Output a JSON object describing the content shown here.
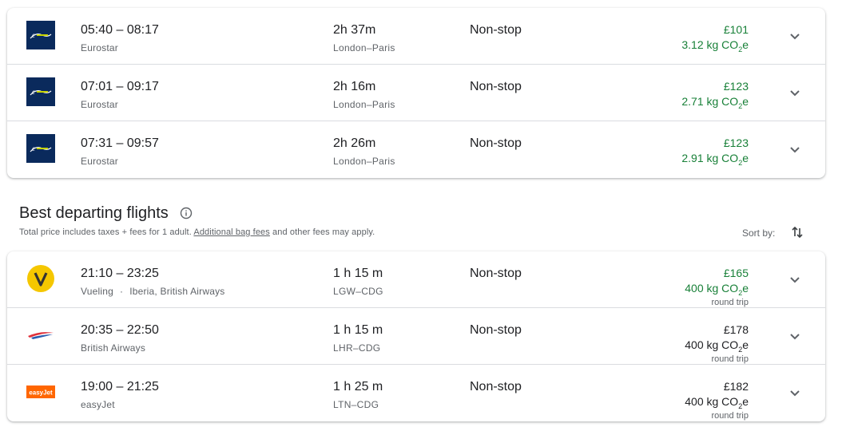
{
  "top_flights": [
    {
      "logo": "eurostar-logo",
      "times": "05:40 – 08:17",
      "carrier": "Eurostar",
      "duration": "2h 37m",
      "route": "London–Paris",
      "stops": "Non-stop",
      "price": "£101",
      "emissions": "3.12 kg CO",
      "emissions_sub": "2",
      "emissions_suffix": "e"
    },
    {
      "logo": "eurostar-logo",
      "times": "07:01 – 09:17",
      "carrier": "Eurostar",
      "duration": "2h 16m",
      "route": "London–Paris",
      "stops": "Non-stop",
      "price": "£123",
      "emissions": "2.71 kg CO",
      "emissions_sub": "2",
      "emissions_suffix": "e"
    },
    {
      "logo": "eurostar-logo",
      "times": "07:31 – 09:57",
      "carrier": "Eurostar",
      "duration": "2h 26m",
      "route": "London–Paris",
      "stops": "Non-stop",
      "price": "£123",
      "emissions": "2.91 kg CO",
      "emissions_sub": "2",
      "emissions_suffix": "e"
    }
  ],
  "best_departing": {
    "title": "Best departing flights",
    "subtitle_pre": "Total price includes taxes + fees for 1 adult. ",
    "subtitle_link": "Additional bag fees",
    "subtitle_post": " and other fees may apply.",
    "sort_label": "Sort by:",
    "flights": [
      {
        "logo": "vueling-logo",
        "times": "21:10 – 23:25",
        "carrier": "Vueling",
        "carrier_sep": "·",
        "carrier_extra": "Iberia, British Airways",
        "duration": "1 h 15 m",
        "route": "LGW–CDG",
        "stops": "Non-stop",
        "price": "£165",
        "emissions": "400 kg CO",
        "emissions_sub": "2",
        "emissions_suffix": "e",
        "trip_type": "round trip"
      },
      {
        "logo": "british-airways-logo",
        "times": "20:35 – 22:50",
        "carrier": "British Airways",
        "duration": "1 h 15 m",
        "route": "LHR–CDG",
        "stops": "Non-stop",
        "price": "£178",
        "emissions": "400 kg CO",
        "emissions_sub": "2",
        "emissions_suffix": "e",
        "trip_type": "round trip"
      },
      {
        "logo": "easyjet-logo",
        "times": "19:00 – 21:25",
        "carrier": "easyJet",
        "duration": "1 h 25 m",
        "route": "LTN–CDG",
        "stops": "Non-stop",
        "price": "£182",
        "emissions": "400 kg CO",
        "emissions_sub": "2",
        "emissions_suffix": "e",
        "trip_type": "round trip"
      }
    ]
  },
  "logo_text": {
    "easyjet": "easyJet"
  },
  "colors": {
    "green": "#188038",
    "text": "#202124",
    "muted": "#5f6368",
    "eurostar_bg": "#0a2a5c",
    "vueling_yellow": "#f5c700",
    "easyjet_orange": "#ff6600",
    "ba_red": "#e0303a",
    "ba_blue": "#2a5db0"
  }
}
